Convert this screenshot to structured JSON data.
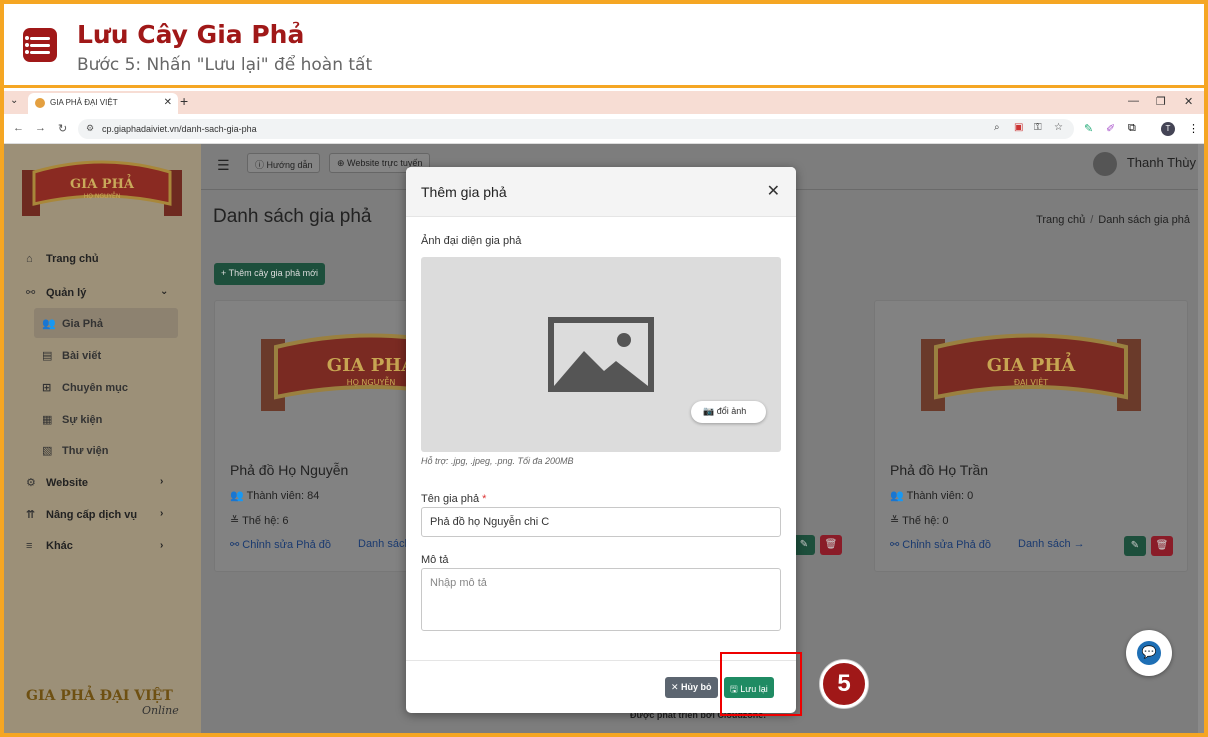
{
  "banner": {
    "title": "Lưu Cây Gia Phả",
    "subtitle": "Bước 5: Nhấn \"Lưu lại\" để hoàn tất"
  },
  "browser": {
    "tab_title": "GIA PHẢ ĐẠI VIỆT",
    "url": "cp.giaphadaiviet.vn/danh-sach-gia-pha",
    "profile_initial": "T"
  },
  "sidebar": {
    "items": [
      {
        "label": "Trang chủ",
        "icon": "home-icon"
      },
      {
        "label": "Quản lý",
        "icon": "sitemap-icon"
      },
      {
        "label": "Gia Phả",
        "icon": "users-icon"
      },
      {
        "label": "Bài viết",
        "icon": "newspaper-icon"
      },
      {
        "label": "Chuyên mục",
        "icon": "grid-icon"
      },
      {
        "label": "Sự kiện",
        "icon": "calendar-icon"
      },
      {
        "label": "Thư viện",
        "icon": "images-icon"
      },
      {
        "label": "Website",
        "icon": "gear-icon"
      },
      {
        "label": "Nâng cấp dịch vụ",
        "icon": "upgrade-icon"
      },
      {
        "label": "Khác",
        "icon": "bars-icon"
      }
    ],
    "logo_text": "GIA PHẢ ĐẠI VIỆT",
    "logo_online": "Online"
  },
  "topnav": {
    "guide": "Hướng dẫn",
    "website": "Website trực tuyến",
    "user": "Thanh Thùy"
  },
  "page": {
    "title": "Danh sách gia phả",
    "breadcrumb": [
      "Trang chủ",
      "Danh sách gia phả"
    ],
    "add_button": "Thêm cây gia phả mới",
    "footer": "Được phát triển bởi Cloudzone."
  },
  "cards": [
    {
      "title": "Phả đồ Họ Nguyễn",
      "members": "Thành viên: 84",
      "generations": "Thế hệ: 6",
      "edit": "Chỉnh sửa Phả đồ",
      "list": "Danh sách",
      "banner_text": "GIA PHẢ",
      "banner_sub": "HỌ NGUYỄN"
    },
    {
      "title": "Phả đồ Họ Trần",
      "members": "Thành viên: 0",
      "generations": "Thế hệ: 0",
      "edit": "Chỉnh sửa Phả đồ",
      "list": "Danh sách →",
      "banner_text": "GIA PHẢ",
      "banner_sub": "ĐẠI VIỆT"
    }
  ],
  "modal": {
    "title": "Thêm gia phả",
    "avatar_label": "Ảnh đại diện gia phả",
    "change_image": "đổi ảnh",
    "hint": "Hỗ trợ: .jpg, .jpeg, .png. Tối đa 200MB",
    "name_label": "Tên gia phả",
    "required_mark": "*",
    "name_value": "Phả đồ họ Nguyễn chi C",
    "desc_label": "Mô tả",
    "desc_placeholder": "Nhập mô tả",
    "cancel": "Hủy bỏ",
    "save": "Lưu lại"
  },
  "step_number": "5",
  "colors": {
    "accent": "#a01818",
    "frame": "#f5a623",
    "save": "#1f8b63",
    "highlight": "#e00000"
  }
}
